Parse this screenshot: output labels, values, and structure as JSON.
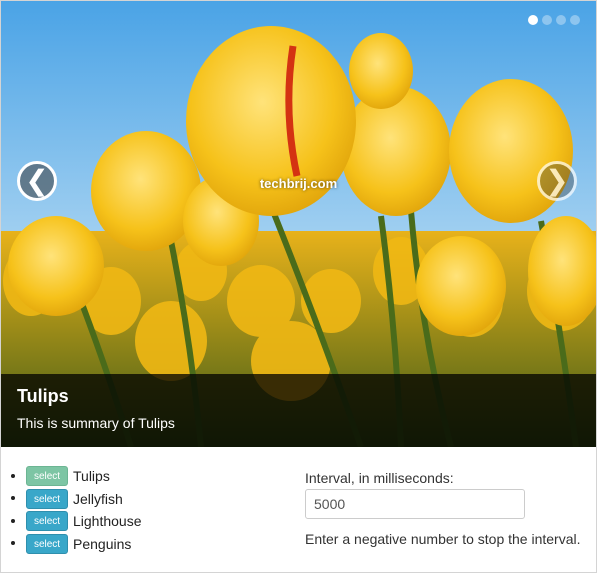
{
  "carousel": {
    "watermark": "techbrij.com",
    "prev_icon": "❮",
    "next_icon": "❯",
    "indicators": [
      {
        "active": true
      },
      {
        "active": false
      },
      {
        "active": false
      },
      {
        "active": false
      }
    ],
    "caption": {
      "title": "Tulips",
      "summary": "This is summary of Tulips"
    },
    "colors": {
      "sky": "#7ab8e8",
      "petal": "#f5c518",
      "stem": "#4a6b1a"
    }
  },
  "slide_list": {
    "items": [
      {
        "button": "select",
        "label": "Tulips",
        "active": true
      },
      {
        "button": "select",
        "label": "Jellyfish",
        "active": false
      },
      {
        "button": "select",
        "label": "Lighthouse",
        "active": false
      },
      {
        "button": "select",
        "label": "Penguins",
        "active": false
      }
    ]
  },
  "interval": {
    "label": "Interval, in milliseconds:",
    "value": "5000",
    "help": "Enter a negative number to stop the interval."
  }
}
